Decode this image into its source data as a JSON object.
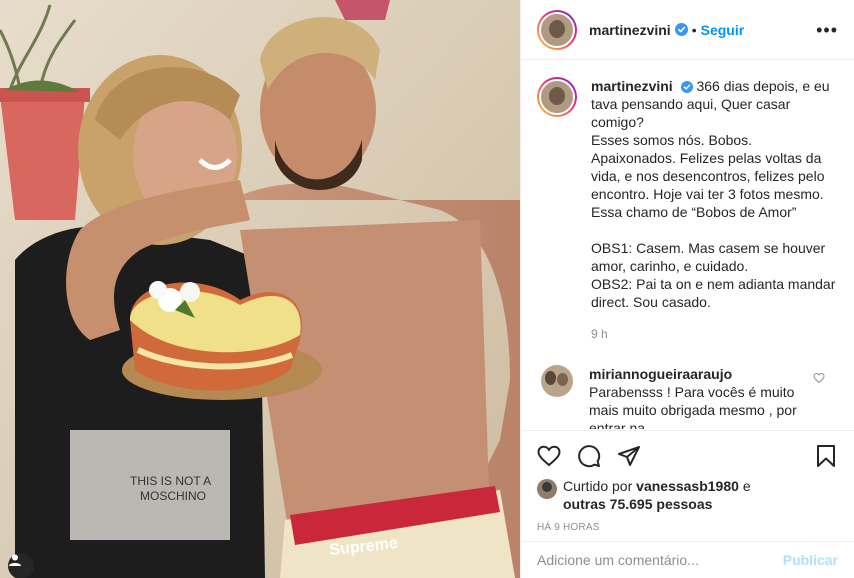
{
  "post": {
    "username": "martinezvini",
    "follow_label": "Seguir",
    "more_label": "•••",
    "caption": "366 dias depois, e eu tava pensando aqui, Quer casar comigo?\nEsses somos nós. Bobos. Apaixonados. Felizes pelas voltas da vida, e nos desencontros, felizes pelo encontro. Hoje vai ter 3 fotos mesmo. Essa chamo de “Bobos de Amor”\n\nOBS1: Casem. Mas casem se houver amor, carinho, e cuidado.\nOBS2: Pai ta on e nem adianta mandar direct. Sou casado.",
    "caption_time": "9 h"
  },
  "comments": [
    {
      "username": "miriannogueiraaraujo",
      "text": "Parabensss ! Para vocês é muito mais muito obrigada mesmo , por entrar na"
    }
  ],
  "likes": {
    "prefix": "Curtido por",
    "user": "vanessasb1980",
    "conj": "e",
    "others": "outras 75.695 pessoas"
  },
  "timestamp": "HÁ 9 HORAS",
  "add_comment": {
    "placeholder": "Adicione um comentário...",
    "publish_label": "Publicar"
  },
  "photo": {
    "shorts_text": "Supreme"
  },
  "colors": {
    "accent": "#0095f6",
    "publish_disabled": "#b2dffc",
    "verified": "#3897f0",
    "secondary_text": "#8e8e8e",
    "border": "#efefef"
  },
  "icons": [
    "heart-icon",
    "comment-icon",
    "share-icon",
    "bookmark-icon",
    "verified-icon",
    "more-icon",
    "user-tag-icon"
  ]
}
